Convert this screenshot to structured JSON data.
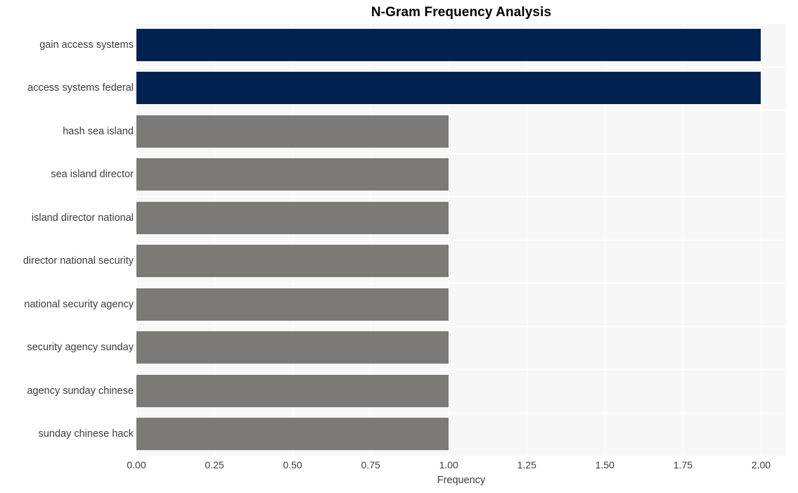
{
  "chart_data": {
    "type": "bar",
    "orientation": "horizontal",
    "title": "N-Gram Frequency Analysis",
    "xlabel": "Frequency",
    "ylabel": "",
    "categories": [
      "gain access systems",
      "access systems federal",
      "hash sea island",
      "sea island director",
      "island director national",
      "director national security",
      "national security agency",
      "security agency sunday",
      "agency sunday chinese",
      "sunday chinese hack"
    ],
    "values": [
      2,
      2,
      1,
      1,
      1,
      1,
      1,
      1,
      1,
      1
    ],
    "bar_colors": [
      "#002251",
      "#002251",
      "#7b7a77",
      "#7b7a77",
      "#7b7a77",
      "#7b7a77",
      "#7b7a77",
      "#7b7a77",
      "#7b7a77",
      "#7b7a77"
    ],
    "xlim": [
      0,
      2.08
    ],
    "xticks": [
      0,
      0.25,
      0.5,
      0.75,
      1,
      1.25,
      1.5,
      1.75,
      2
    ],
    "xtick_labels": [
      "0.00",
      "0.25",
      "0.50",
      "0.75",
      "1.00",
      "1.25",
      "1.50",
      "1.75",
      "2.00"
    ],
    "grid": true,
    "grid_color": "#ffffff",
    "plot_background": "#f7f7f8",
    "figure_background": "#ffffff",
    "legend": null,
    "highlight_color": "#002251",
    "default_color": "#7b7a77"
  }
}
